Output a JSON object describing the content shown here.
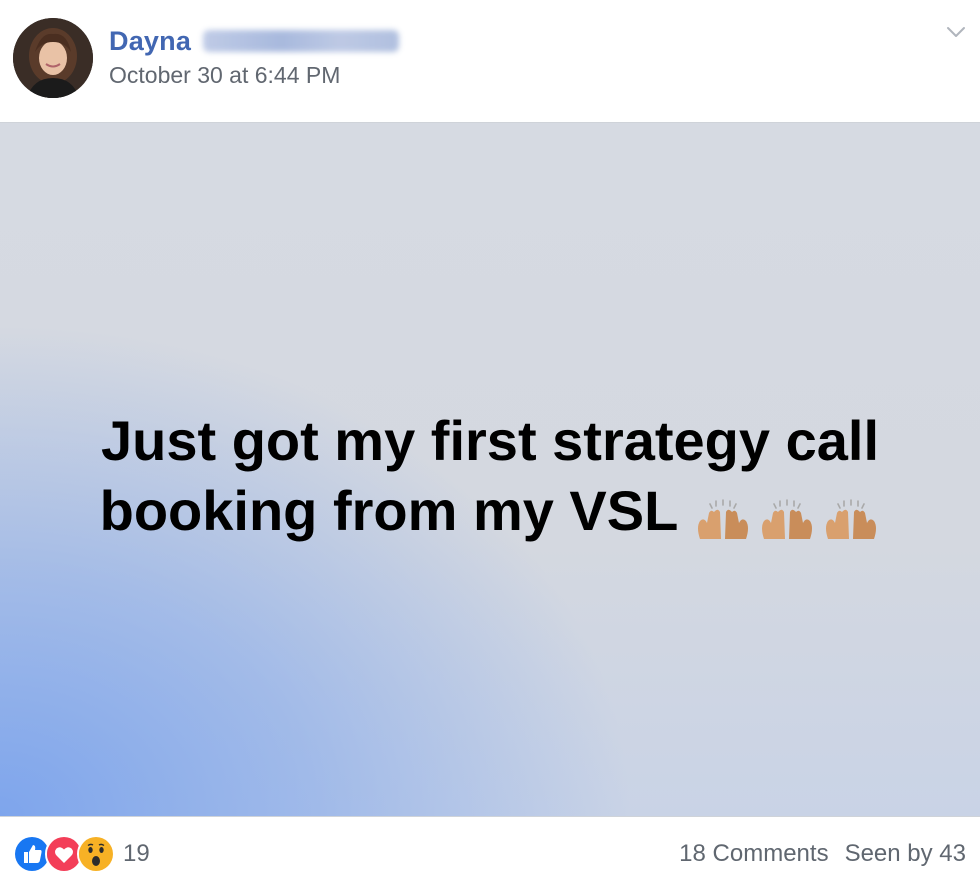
{
  "author": {
    "first_name": "Dayna",
    "timestamp": "October 30 at 6:44 PM"
  },
  "post": {
    "line1": "Just got my first strategy call",
    "line2": "booking from my VSL",
    "emoji": [
      "raised-hands-icon",
      "raised-hands-icon",
      "raised-hands-icon"
    ]
  },
  "footer": {
    "reaction_icons": [
      "like-icon",
      "love-icon",
      "wow-icon"
    ],
    "reaction_count": "19",
    "comments": "18 Comments",
    "seen_by": "Seen by 43"
  },
  "colors": {
    "author_name": "#4267b2",
    "secondary_text": "#616770",
    "like": "#1877f2",
    "love": "#f33e58",
    "wow": "#f7b125"
  }
}
